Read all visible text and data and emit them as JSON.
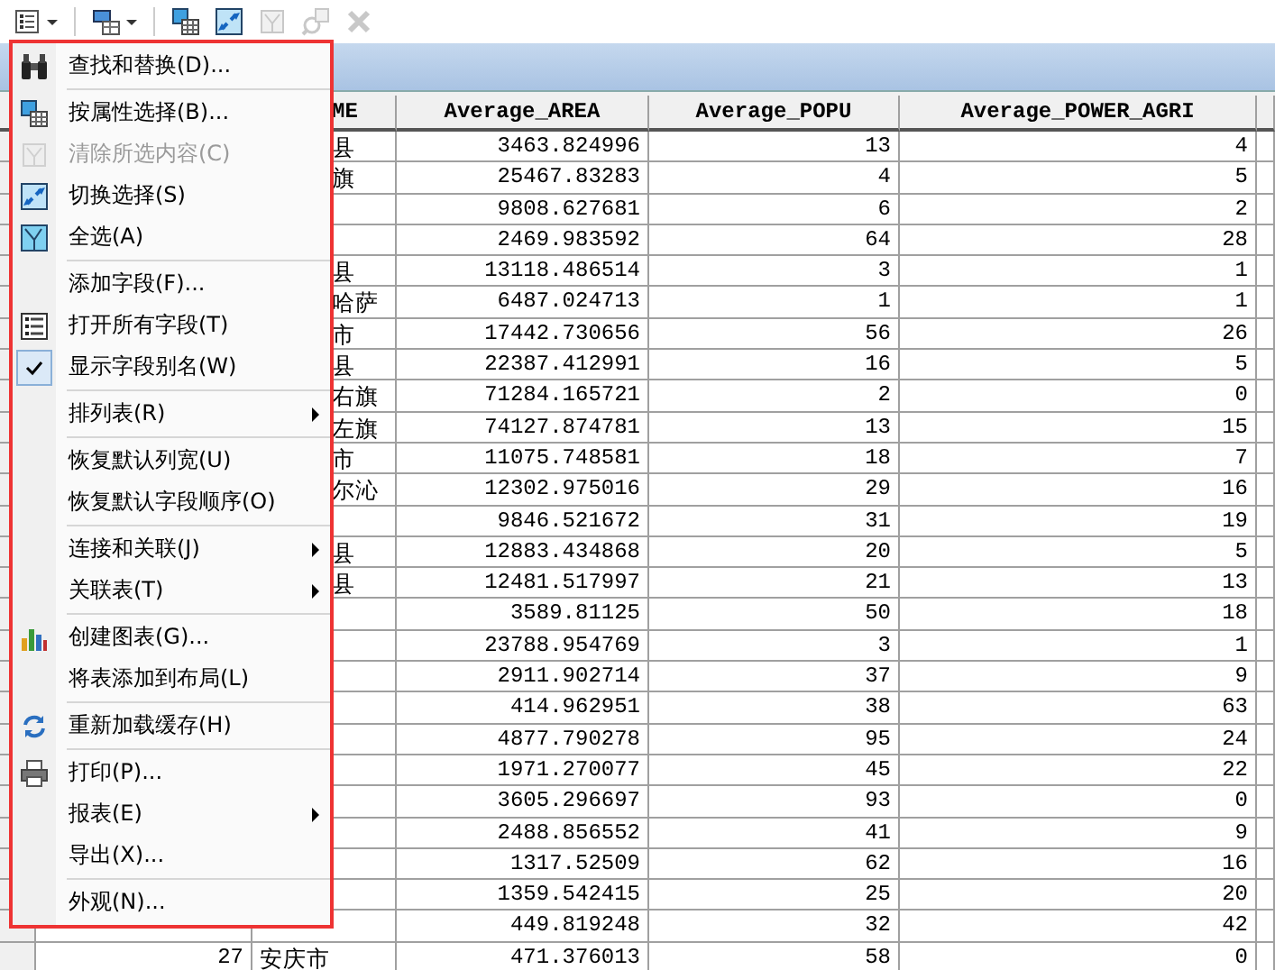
{
  "toolbar": [
    {
      "kind": "table-options",
      "dropdown": true,
      "disabled": false
    },
    {
      "kind": "related-tables",
      "dropdown": true,
      "disabled": false
    },
    {
      "kind": "select-by-attributes",
      "dropdown": false,
      "disabled": false
    },
    {
      "kind": "switch-selection",
      "dropdown": false,
      "disabled": false
    },
    {
      "kind": "clear-selection",
      "dropdown": false,
      "disabled": true
    },
    {
      "kind": "zoom-selected",
      "dropdown": false,
      "disabled": true
    },
    {
      "kind": "delete",
      "dropdown": false,
      "disabled": true
    }
  ],
  "table": {
    "columns": [
      "ME",
      "Average_AREA",
      "Average_POPU",
      "Average_POWER_AGRI"
    ],
    "rows": [
      {
        "name": "县",
        "area": "3463.824996",
        "popu": "13",
        "agri": "4"
      },
      {
        "name": "旗",
        "area": "25467.83283",
        "popu": "4",
        "agri": "5"
      },
      {
        "area": "9808.627681",
        "popu": "6",
        "agri": "2"
      },
      {
        "area": "2469.983592",
        "popu": "64",
        "agri": "28"
      },
      {
        "name": "县",
        "area": "13118.486514",
        "popu": "3",
        "agri": "1"
      },
      {
        "name": "哈萨",
        "area": "6487.024713",
        "popu": "1",
        "agri": "1"
      },
      {
        "name": "市",
        "area": "17442.730656",
        "popu": "56",
        "agri": "26"
      },
      {
        "name": "县",
        "area": "22387.412991",
        "popu": "16",
        "agri": "5"
      },
      {
        "name": "右旗",
        "area": "71284.165721",
        "popu": "2",
        "agri": "0"
      },
      {
        "name": "左旗",
        "area": "74127.874781",
        "popu": "13",
        "agri": "15"
      },
      {
        "name": "市",
        "area": "11075.748581",
        "popu": "18",
        "agri": "7"
      },
      {
        "name": "尔沁",
        "area": "12302.975016",
        "popu": "29",
        "agri": "16"
      },
      {
        "area": "9846.521672",
        "popu": "31",
        "agri": "19"
      },
      {
        "name": "县",
        "area": "12883.434868",
        "popu": "20",
        "agri": "5"
      },
      {
        "name": "县",
        "area": "12481.517997",
        "popu": "21",
        "agri": "13"
      },
      {
        "area": "3589.81125",
        "popu": "50",
        "agri": "18"
      },
      {
        "area": "23788.954769",
        "popu": "3",
        "agri": "1"
      },
      {
        "area": "2911.902714",
        "popu": "37",
        "agri": "9"
      },
      {
        "area": "414.962951",
        "popu": "38",
        "agri": "63"
      },
      {
        "area": "4877.790278",
        "popu": "95",
        "agri": "24"
      },
      {
        "area": "1971.270077",
        "popu": "45",
        "agri": "22"
      },
      {
        "area": "3605.296697",
        "popu": "93",
        "agri": "0"
      },
      {
        "area": "2488.856552",
        "popu": "41",
        "agri": "9"
      },
      {
        "area": "1317.52509",
        "popu": "62",
        "agri": "16"
      },
      {
        "area": "1359.542415",
        "popu": "25",
        "agri": "20"
      },
      {
        "area": "449.819248",
        "popu": "32",
        "agri": "42"
      },
      {
        "id": "27",
        "name": "安庆市",
        "area": "471.376013",
        "popu": "58",
        "agri": "0"
      }
    ]
  },
  "menu": {
    "groups": [
      [
        {
          "label": "查找和替换(D)...",
          "kind": "binoculars",
          "disabled": false,
          "checked": false,
          "submenu": false
        }
      ],
      [
        {
          "label": "按属性选择(B)...",
          "kind": "select-by-attributes",
          "disabled": false,
          "checked": false,
          "submenu": false
        },
        {
          "label": "清除所选内容(C)",
          "kind": "clear-selection",
          "disabled": true,
          "checked": false,
          "submenu": false
        },
        {
          "label": "切换选择(S)",
          "kind": "switch-selection",
          "disabled": false,
          "checked": false,
          "submenu": false
        },
        {
          "label": "全选(A)",
          "kind": "select-all",
          "disabled": false,
          "checked": false,
          "submenu": false
        }
      ],
      [
        {
          "label": "添加字段(F)...",
          "disabled": false,
          "checked": false,
          "submenu": false
        },
        {
          "label": "打开所有字段(T)",
          "kind": "field-list",
          "disabled": false,
          "checked": false,
          "submenu": false
        },
        {
          "label": "显示字段别名(W)",
          "disabled": false,
          "checked": true,
          "submenu": false
        }
      ],
      [
        {
          "label": "排列表(R)",
          "disabled": false,
          "checked": false,
          "submenu": true
        }
      ],
      [
        {
          "label": "恢复默认列宽(U)",
          "disabled": false,
          "checked": false,
          "submenu": false
        },
        {
          "label": "恢复默认字段顺序(O)",
          "disabled": false,
          "checked": false,
          "submenu": false
        }
      ],
      [
        {
          "label": "连接和关联(J)",
          "disabled": false,
          "checked": false,
          "submenu": true
        },
        {
          "label": "关联表(T)",
          "disabled": false,
          "checked": false,
          "submenu": true
        }
      ],
      [
        {
          "label": "创建图表(G)...",
          "kind": "bar-chart",
          "disabled": false,
          "checked": false,
          "submenu": false
        },
        {
          "label": "将表添加到布局(L)",
          "disabled": false,
          "checked": false,
          "submenu": false
        }
      ],
      [
        {
          "label": "重新加载缓存(H)",
          "kind": "refresh",
          "disabled": false,
          "checked": false,
          "submenu": false
        }
      ],
      [
        {
          "label": "打印(P)...",
          "kind": "printer",
          "disabled": false,
          "checked": false,
          "submenu": false
        },
        {
          "label": "报表(E)",
          "disabled": false,
          "checked": false,
          "submenu": true
        },
        {
          "label": "导出(X)...",
          "disabled": false,
          "checked": false,
          "submenu": false
        }
      ],
      [
        {
          "label": "外观(N)...",
          "disabled": false,
          "checked": false,
          "submenu": false
        }
      ]
    ]
  }
}
